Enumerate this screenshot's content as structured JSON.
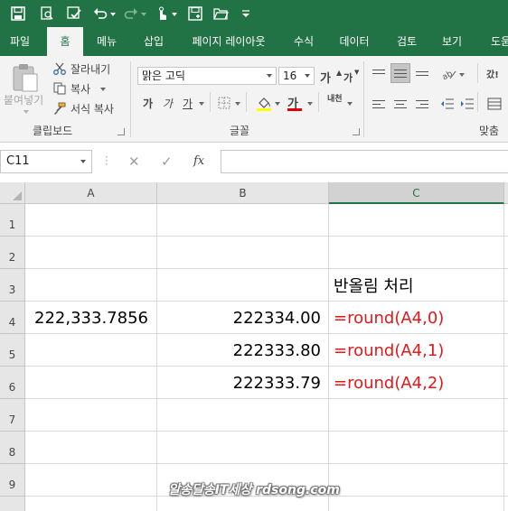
{
  "tabs": [
    "파일",
    "홈",
    "메뉴",
    "삽입",
    "페이지 레이아웃",
    "수식",
    "데이터",
    "검토",
    "보기",
    "도움"
  ],
  "active_tab": "홈",
  "ribbon": {
    "clipboard": {
      "paste_label": "붙여넣기",
      "cut_label": "잘라내기",
      "copy_label": "복사",
      "format_painter_label": "서식 복사",
      "group_label": "클립보드"
    },
    "font": {
      "font_name": "맑은 고딕",
      "font_size": "16",
      "grow_label": "가",
      "shrink_label": "가",
      "bold_label": "가",
      "italic_label": "가",
      "underline_label": "가",
      "font_color_label": "가",
      "phonetic_label": "내천",
      "group_label": "글꼴",
      "fill_color": "#ffff00",
      "font_color": "#e00000"
    },
    "alignment": {
      "group_label": "맞춤",
      "wrap_label": "갔!"
    }
  },
  "formula_bar": {
    "name_box": "C11",
    "fx_label": "fx",
    "formula": ""
  },
  "sheet": {
    "columns": [
      "A",
      "B",
      "C"
    ],
    "selected_column": "C",
    "rows": [
      "1",
      "2",
      "3",
      "4",
      "5",
      "6",
      "7",
      "8",
      "9"
    ],
    "cells": {
      "C3": "반올림 처리",
      "A4": "222,333.7856",
      "B4": "222334.00",
      "C4": "=round(A4,0)",
      "B5": "222333.80",
      "C5": "=round(A4,1)",
      "B6": "222333.79",
      "C6": "=round(A4,2)"
    },
    "formula_text_color": "#e0191b"
  },
  "watermark": "알송달송IT세상 rdsong.com",
  "colors": {
    "excel_green": "#217346",
    "ribbon_bg": "#f3f3f3",
    "header_bg": "#e6e6e6"
  }
}
